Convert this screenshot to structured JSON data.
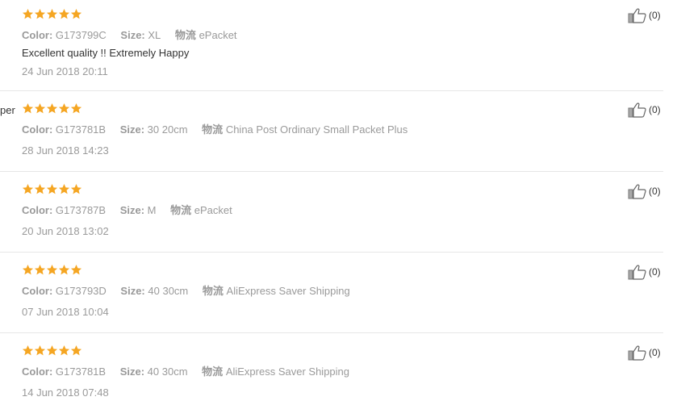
{
  "labels": {
    "color": "Color:",
    "size": "Size:",
    "shipping": "物流"
  },
  "colors": {
    "star": "#f5a623",
    "text": "#333333",
    "muted": "#999999",
    "divider": "#e6e6e6"
  },
  "reviews": [
    {
      "rating": 5,
      "reviewer_fragment": "",
      "color": "G173799C",
      "size": "XL",
      "shipping": "ePacket",
      "text": "Excellent quality !! Extremely Happy",
      "date": "24 Jun 2018 20:11",
      "helpful_count": "(0)"
    },
    {
      "rating": 5,
      "reviewer_fragment": "per",
      "color": "G173781B",
      "size": "30 20cm",
      "shipping": "China Post Ordinary Small Packet Plus",
      "text": "",
      "date": "28 Jun 2018 14:23",
      "helpful_count": "(0)"
    },
    {
      "rating": 5,
      "reviewer_fragment": "",
      "color": "G173787B",
      "size": "M",
      "shipping": "ePacket",
      "text": "",
      "date": "20 Jun 2018 13:02",
      "helpful_count": "(0)"
    },
    {
      "rating": 5,
      "reviewer_fragment": "",
      "color": "G173793D",
      "size": "40 30cm",
      "shipping": "AliExpress Saver Shipping",
      "text": "",
      "date": "07 Jun 2018 10:04",
      "helpful_count": "(0)"
    },
    {
      "rating": 5,
      "reviewer_fragment": "",
      "color": "G173781B",
      "size": "40 30cm",
      "shipping": "AliExpress Saver Shipping",
      "text": "",
      "date": "14 Jun 2018 07:48",
      "helpful_count": "(0)"
    }
  ]
}
